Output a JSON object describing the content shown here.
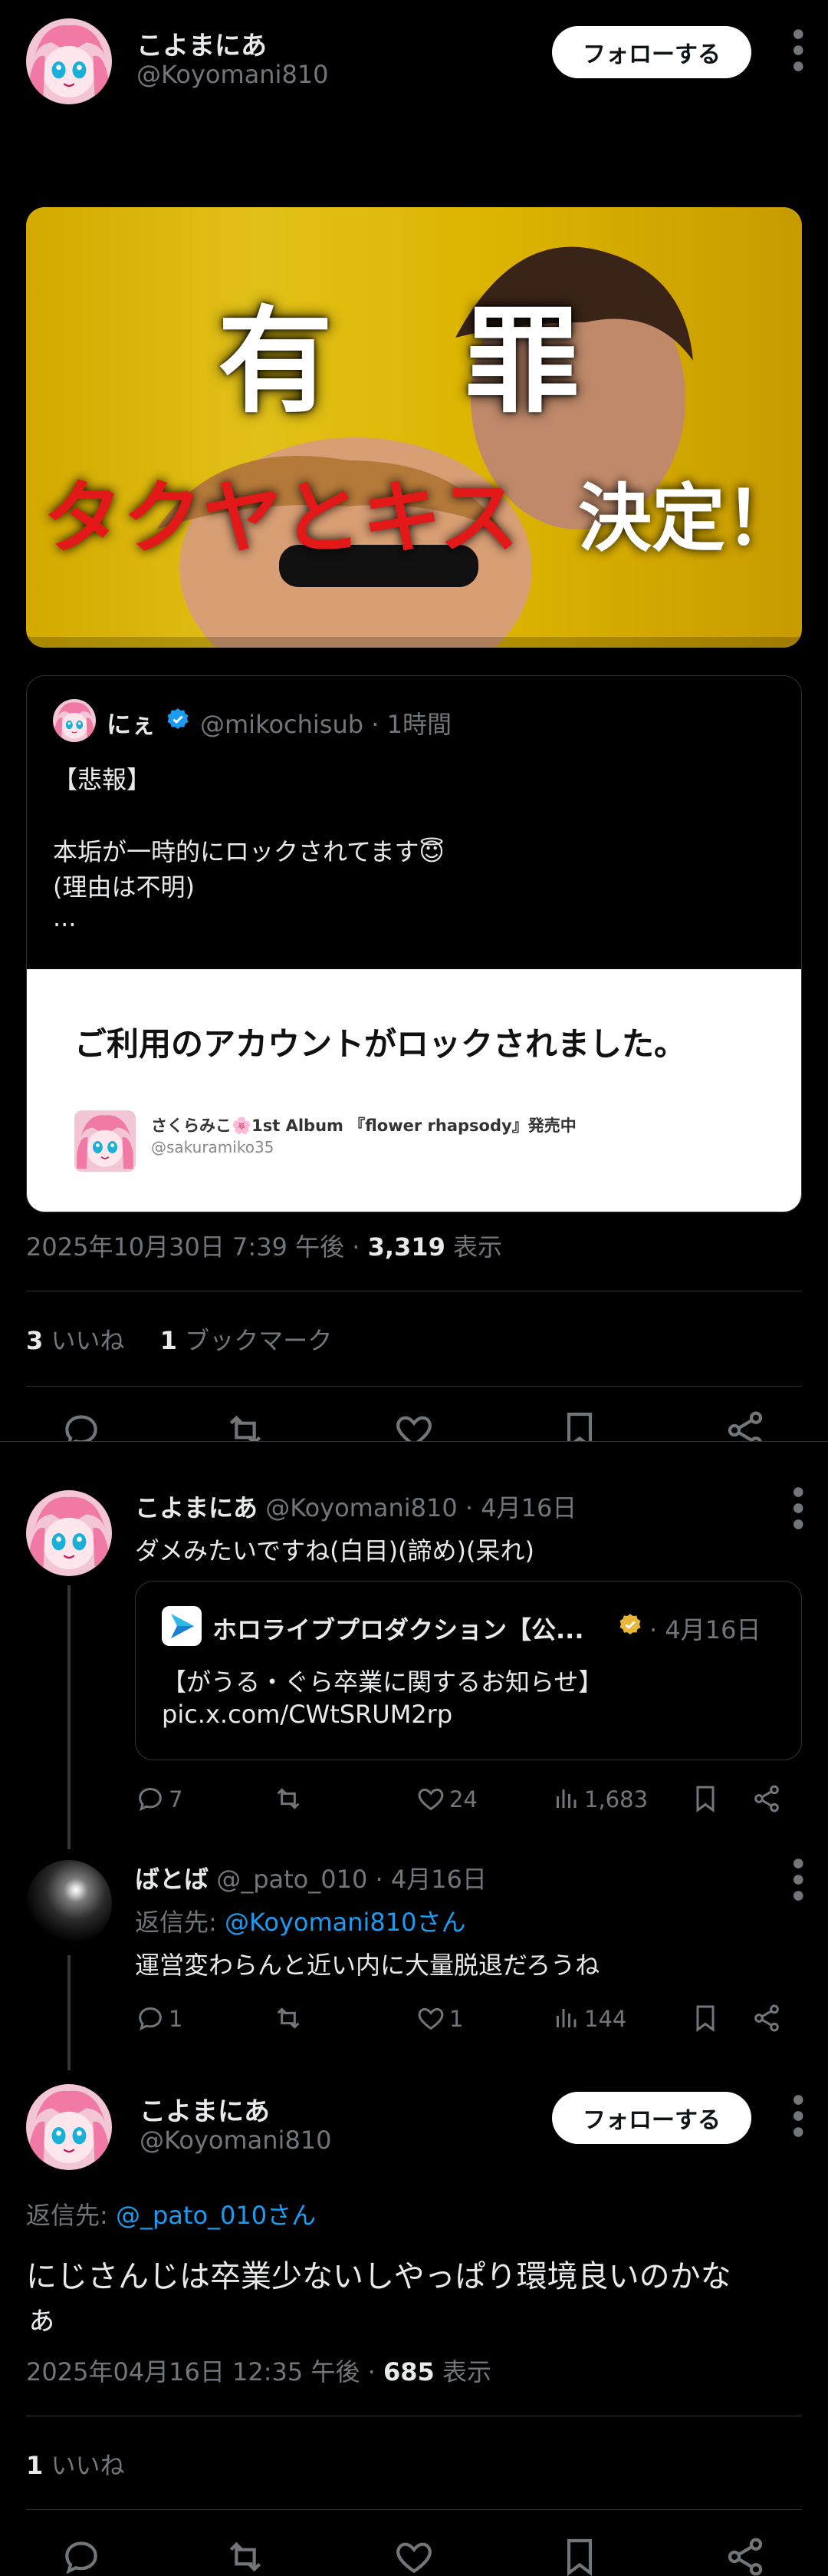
{
  "main_post": {
    "author_name": "こよまにあ",
    "author_handle": "@Koyomani810",
    "follow_label": "フォローする",
    "image_title_line1": "有 罪",
    "image_title_line2a": "タクヤとキス",
    "image_title_line2b": "決定！",
    "quote": {
      "author_name": "にぇ",
      "author_handle": "@mikochisub",
      "time": "1時間",
      "text_line1": "【悲報】",
      "text_line2": "本垢が一時的にロックされてます😇",
      "text_line3": "(理由は不明)",
      "text_line4": "...",
      "image_heading": "ご利用のアカウントがロックされました。",
      "image_user_name": "さくらみこ🌸1st Album 『flower rhapsody』発売中",
      "image_user_handle": "@sakuramiko35"
    },
    "timestamp": "2025年10月30日 7:39 午後",
    "views_count": "3,319",
    "views_label": "表示",
    "likes_count": "3",
    "likes_label": "いいね",
    "bookmarks_count": "1",
    "bookmarks_label": "ブックマーク"
  },
  "replies": [
    {
      "author_name": "こよまにあ",
      "author_handle": "@Koyomani810",
      "time": "4月16日",
      "text": "ダメみたいですね(白目)(諦め)(呆れ)",
      "quote": {
        "author_name": "ホロライブプロダクション【公...",
        "time": "4月16日",
        "text_line1": "【がうる・ぐら卒業に関するお知らせ】",
        "text_line2": "pic.x.com/CWtSRUM2rp"
      },
      "reply_count": "7",
      "like_count": "24",
      "view_count": "1,683"
    },
    {
      "author_name": "ばとば",
      "author_handle": "@_pato_010",
      "time": "4月16日",
      "reply_to_label": "返信先:",
      "reply_to_handle": "@Koyomani810さん",
      "text": "運営変わらんと近い内に大量脱退だろうね",
      "reply_count": "1",
      "like_count": "1",
      "view_count": "144"
    }
  ],
  "focus_post": {
    "author_name": "こよまにあ",
    "author_handle": "@Koyomani810",
    "follow_label": "フォローする",
    "reply_to_label": "返信先:",
    "reply_to_handle": "@_pato_010さん",
    "text_line1": "にじさんじは卒業少ないしやっぱり環境良いのかな",
    "text_line2": "ぁ",
    "timestamp": "2025年04月16日 12:35 午後",
    "views_count": "685",
    "views_label": "表示",
    "likes_count": "1",
    "likes_label": "いいね"
  },
  "icons": [
    "reply-icon",
    "retweet-icon",
    "like-icon",
    "bookmark-icon",
    "share-icon",
    "views-icon",
    "verified-badge-icon",
    "more-icon"
  ],
  "colors": {
    "background": "#000000",
    "text": "#e7e9ea",
    "secondary": "#71767b",
    "link": "#1d9bf0",
    "divider": "#2f3336",
    "verified_blue": "#1d9bf0",
    "verified_gold": "#e8b73a"
  }
}
